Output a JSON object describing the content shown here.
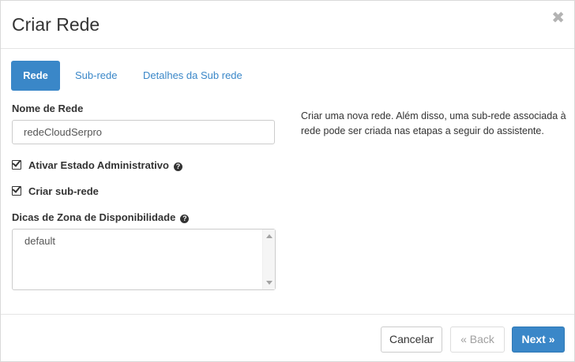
{
  "modal": {
    "title": "Criar Rede",
    "close_glyph": "✖"
  },
  "tabs": [
    {
      "label": "Rede",
      "active": true
    },
    {
      "label": "Sub-rede",
      "active": false
    },
    {
      "label": "Detalhes da Sub rede",
      "active": false
    }
  ],
  "form": {
    "network_name_label": "Nome de Rede",
    "network_name_value": "redeCloudSerpro",
    "admin_state_label": "Ativar Estado Administrativo",
    "admin_state_checked": true,
    "create_subnet_label": "Criar sub-rede",
    "create_subnet_checked": true,
    "az_hints_label": "Dicas de Zona de Disponibilidade",
    "az_hints_value": "default"
  },
  "help_text": "Criar uma nova rede. Além disso, uma sub-rede associada à rede pode ser criada nas etapas a seguir do assistente.",
  "footer": {
    "cancel_label": "Cancelar",
    "back_label": "« Back",
    "next_label": "Next »"
  },
  "colors": {
    "primary": "#3a87c8",
    "disabled_text": "#a0a0a0"
  },
  "icons": {
    "close": "close-icon",
    "checkbox": "checkbox-checked-icon",
    "help": "question-circle-icon"
  }
}
